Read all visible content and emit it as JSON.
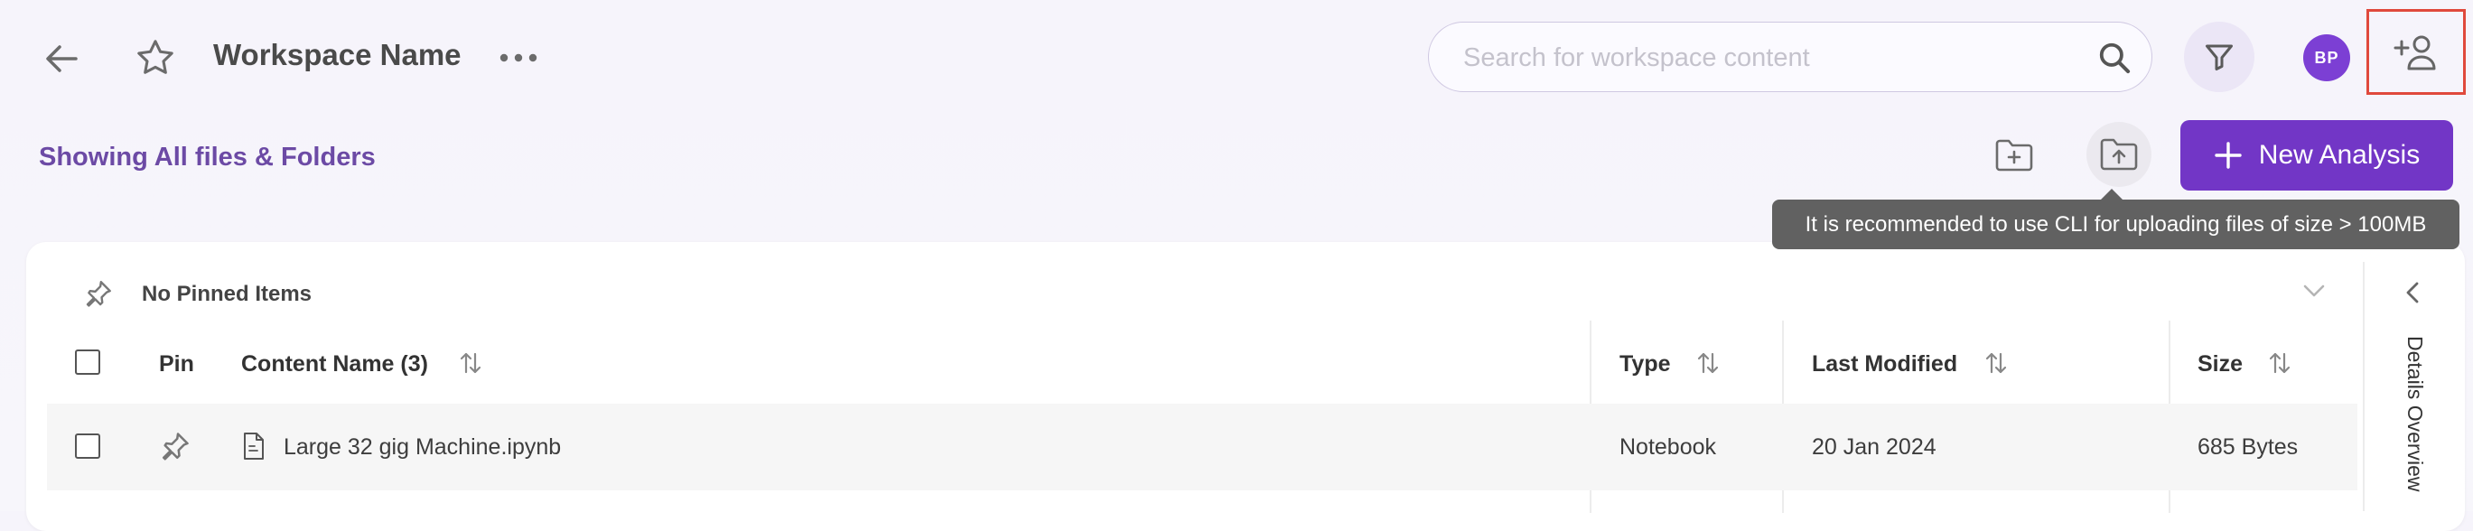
{
  "topbar": {
    "workspace_title": "Workspace Name",
    "search_placeholder": "Search for workspace content",
    "avatar_initials": "BP"
  },
  "toolbar": {
    "showing_label": "Showing All files & Folders",
    "new_analysis_label": "New Analysis",
    "upload_tooltip": "It is recommended to use CLI for uploading files of size > 100MB"
  },
  "pinned": {
    "label": "No Pinned Items"
  },
  "table": {
    "columns": {
      "pin": "Pin",
      "content_name": "Content Name (3)",
      "type": "Type",
      "last_modified": "Last Modified",
      "size": "Size"
    },
    "rows": [
      {
        "name": "Large 32 gig Machine.ipynb",
        "type": "Notebook",
        "last_modified": "20 Jan 2024",
        "size": "685 Bytes"
      }
    ]
  },
  "details_panel": {
    "label": "Details Overview"
  },
  "colors": {
    "accent": "#7236c6",
    "highlight_border": "#e0493c",
    "tooltip_bg": "#616161"
  }
}
